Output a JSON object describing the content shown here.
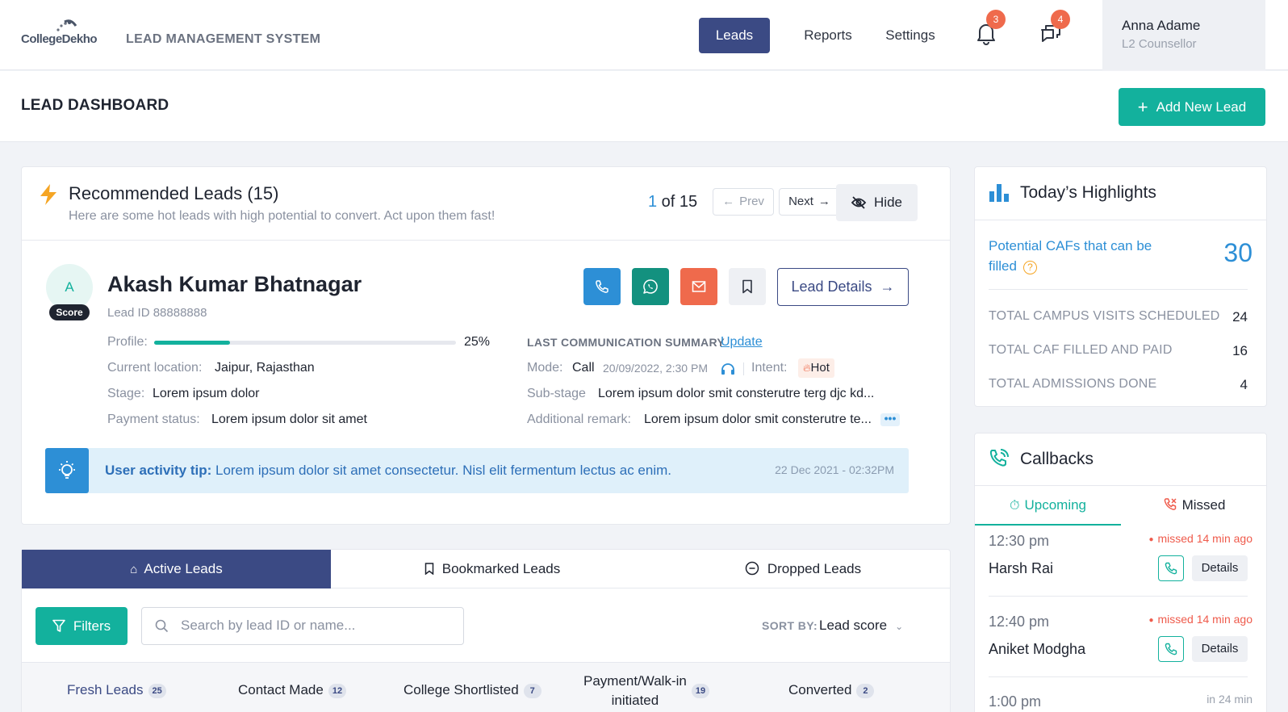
{
  "brand": {
    "logo_text": "CollegeDekho",
    "system_title": "LEAD MANAGEMENT SYSTEM"
  },
  "nav": {
    "items": [
      {
        "label": "Leads",
        "active": true
      },
      {
        "label": "Reports"
      },
      {
        "label": "Settings"
      }
    ],
    "notifications_count": "3",
    "messages_count": "4",
    "user": {
      "name": "Anna Adame",
      "role": "L2 Counsellor"
    }
  },
  "header": {
    "title": "LEAD DASHBOARD",
    "add_lead_label": "Add New Lead"
  },
  "recommended": {
    "title": "Recommended Leads (15)",
    "subtitle": "Here are some hot leads with high potential to convert. Act upon them fast!",
    "pager": {
      "current": "1",
      "of_text": " of 15",
      "prev": "Prev",
      "next": "Next"
    },
    "hide_label": "Hide",
    "lead": {
      "initial": "A",
      "score_label": "Score",
      "name": "Akash Kumar Bhatnagar",
      "lead_id": "Lead ID 88888888",
      "details_label": "Lead Details",
      "profile_label": "Profile:",
      "profile_percent": 25,
      "profile_percent_text": "25%",
      "location_label": "Current location:",
      "location": "Jaipur, Rajasthan",
      "stage_label": "Stage:",
      "stage": "Lorem ipsum dolor",
      "payment_label": "Payment status:",
      "payment": "Lorem ipsum dolor sit amet",
      "comm_title": "LAST COMMUNICATION SUMMARY",
      "update_label": "Update",
      "mode_label": "Mode:",
      "mode": "Call",
      "mode_time": "20/09/2022, 2:30 PM",
      "intent_label": "Intent:",
      "intent": "Hot",
      "substage_label": "Sub-stage",
      "substage": "Lorem ipsum dolor smit consterutre terg djc kd...",
      "remark_label": "Additional remark:",
      "remark": "Lorem ipsum dolor smit consterutre te...",
      "more": "•••"
    },
    "tip": {
      "label": "User activity tip:",
      "text": " Lorem ipsum dolor sit amet consectetur. Nisl elit fermentum lectus ac enim.",
      "date": "22 Dec 2021 - 02:32PM"
    }
  },
  "leads": {
    "tabs": [
      {
        "label": "Active Leads",
        "active": true
      },
      {
        "label": "Bookmarked Leads"
      },
      {
        "label": "Dropped Leads"
      }
    ],
    "filters_label": "Filters",
    "search_placeholder": "Search by lead ID or name...",
    "sort_label": "SORT BY:",
    "sort_value": "Lead score",
    "stages": [
      {
        "label": "Fresh Leads",
        "count": "25"
      },
      {
        "label": "Contact Made",
        "count": "12"
      },
      {
        "label": "College Shortlisted",
        "count": "7"
      },
      {
        "label": "Payment/Walk-in",
        "label2": "initiated",
        "count": "19"
      },
      {
        "label": "Converted",
        "count": "2"
      }
    ]
  },
  "highlights": {
    "title": "Today’s Highlights",
    "cafs_label": "Potential CAFs that can be filled",
    "cafs_value": "30",
    "rows": [
      {
        "label": "TOTAL CAMPUS VISITS SCHEDULED",
        "value": "24"
      },
      {
        "label": "TOTAL CAF FILLED AND PAID",
        "value": "16"
      },
      {
        "label": "TOTAL ADMISSIONS DONE",
        "value": "4"
      }
    ]
  },
  "callbacks": {
    "title": "Callbacks",
    "tabs": [
      {
        "label": "Upcoming",
        "active": true
      },
      {
        "label": "Missed"
      }
    ],
    "items": [
      {
        "time": "12:30 pm",
        "status": "missed 14 min ago",
        "name": "Harsh Rai",
        "details": "Details"
      },
      {
        "time": "12:40 pm",
        "status": "missed 14 min ago",
        "name": "Aniket Modgha",
        "details": "Details"
      }
    ],
    "partial_time": "1:00 pm",
    "partial_status": "in 24 min"
  },
  "colors": {
    "primary": "#3b4a84",
    "accent": "#13b19d",
    "link": "#2d8fd6",
    "danger": "#ef5b4c"
  }
}
